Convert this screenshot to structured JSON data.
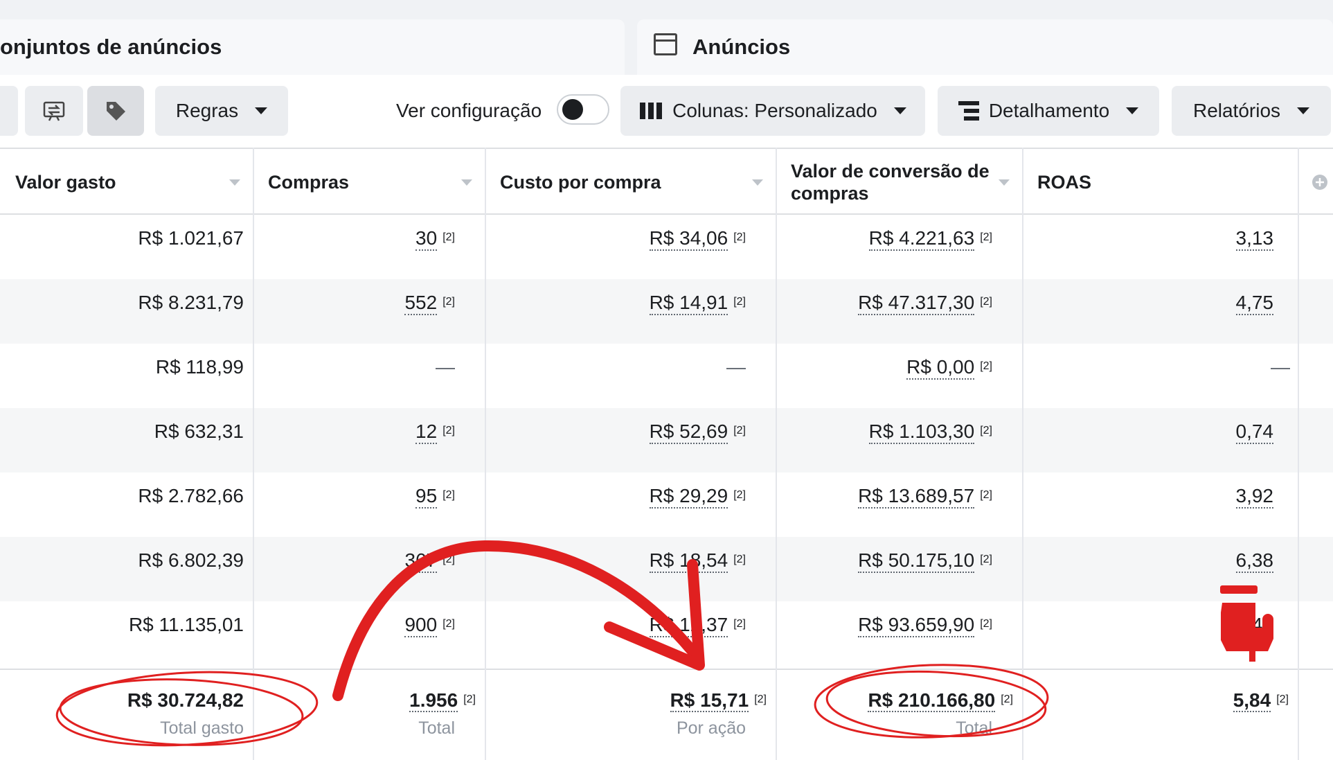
{
  "tabs": [
    {
      "label": "onjuntos de anúncios"
    },
    {
      "label": "Anúncios",
      "icon": "ad-window-icon"
    }
  ],
  "toolbar": {
    "regras_label": "Regras",
    "ver_config_label": "Ver configuração",
    "toggle_on": false,
    "colunas_label": "Colunas: Personalizado",
    "detalhamento_label": "Detalhamento",
    "relatorios_label": "Relatórios"
  },
  "columns": [
    "Valor gasto",
    "Compras",
    "Custo por compra",
    "Valor de conversão de compras",
    "ROAS"
  ],
  "note_marker": "[2]",
  "rows": [
    {
      "valor": "R$ 1.021,67",
      "compras": "30",
      "custo": "R$ 34,06",
      "conversao": "R$ 4.221,63",
      "roas": "3,13"
    },
    {
      "valor": "R$ 8.231,79",
      "compras": "552",
      "custo": "R$ 14,91",
      "conversao": "R$ 47.317,30",
      "roas": "4,75"
    },
    {
      "valor": "R$ 118,99",
      "compras": "—",
      "custo": "—",
      "conversao": "R$ 0,00",
      "roas": "—"
    },
    {
      "valor": "R$ 632,31",
      "compras": "12",
      "custo": "R$ 52,69",
      "conversao": "R$ 1.103,30",
      "roas": "0,74"
    },
    {
      "valor": "R$ 2.782,66",
      "compras": "95",
      "custo": "R$ 29,29",
      "conversao": "R$ 13.689,57",
      "roas": "3,92"
    },
    {
      "valor": "R$ 6.802,39",
      "compras": "367",
      "custo": "R$ 18,54",
      "conversao": "R$ 50.175,10",
      "roas": "6,38"
    },
    {
      "valor": "R$ 11.135,01",
      "compras": "900",
      "custo": "R$ 12,37",
      "conversao": "R$ 93.659,90",
      "roas": "8,41"
    }
  ],
  "totals": {
    "valor": "R$ 30.724,82",
    "valor_sub": "Total gasto",
    "compras": "1.956",
    "compras_sub": "Total",
    "custo": "R$ 15,71",
    "custo_sub": "Por ação",
    "conversao": "R$ 210.166,80",
    "conversao_sub": "Total",
    "roas": "5,84"
  },
  "annotation_color": "#e02020"
}
